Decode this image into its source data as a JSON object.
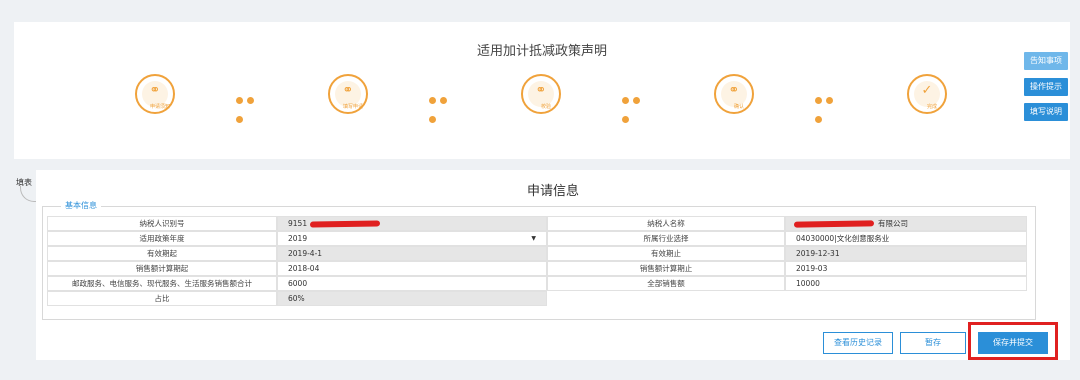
{
  "header": {
    "title": "适用加计抵减政策声明",
    "steps": [
      {
        "label": "申请须知",
        "glyph": "⚭"
      },
      {
        "label": "填写申请",
        "glyph": "⚭"
      },
      {
        "label": "校验",
        "glyph": "⚭"
      },
      {
        "label": "确认",
        "glyph": "⚭"
      },
      {
        "label": "完成",
        "glyph": "✓"
      }
    ]
  },
  "side_buttons": {
    "notice": "告知事项",
    "tips": "操作提示",
    "instructions": "填写说明"
  },
  "form": {
    "tag": "填表",
    "title": "申请信息",
    "legend": "基本信息",
    "rows": [
      {
        "l1": "纳税人识别号",
        "v1": "9151",
        "l2": "纳税人名称",
        "v2": "有限公司"
      },
      {
        "l1": "适用政策年度",
        "v1": "2019",
        "l2": "所属行业选择",
        "v2": "04030000|文化创意服务业"
      },
      {
        "l1": "有效期起",
        "v1": "2019-4-1",
        "l2": "有效期止",
        "v2": "2019-12-31"
      },
      {
        "l1": "销售额计算期起",
        "v1": "2018-04",
        "l2": "销售额计算期止",
        "v2": "2019-03"
      },
      {
        "l1": "邮政服务、电信服务、现代服务、生活服务销售额合计",
        "v1": "6000",
        "l2": "全部销售额",
        "v2": "10000"
      },
      {
        "l1": "占比",
        "v1": "60%"
      }
    ]
  },
  "actions": {
    "history": "查看历史记录",
    "save_draft": "暂存",
    "save_submit": "保存并提交"
  },
  "colors": {
    "accent": "#2b8fd8",
    "step": "#f0a23b",
    "highlight": "#e02020"
  }
}
